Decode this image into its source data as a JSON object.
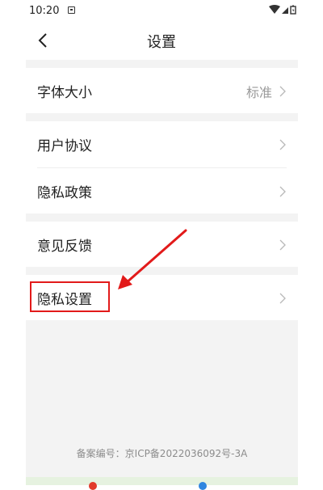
{
  "status_bar": {
    "time": "10:20",
    "icons": [
      "notification-icon",
      "wifi-icon",
      "signal-icon",
      "battery-icon"
    ]
  },
  "nav": {
    "title": "设置",
    "back_icon": "back-arrow-icon"
  },
  "settings": {
    "font_size": {
      "label": "字体大小",
      "value": "标准"
    },
    "user_agreement": {
      "label": "用户协议"
    },
    "privacy_policy": {
      "label": "隐私政策"
    },
    "feedback": {
      "label": "意见反馈"
    },
    "privacy_settings": {
      "label": "隐私设置"
    }
  },
  "annotation": {
    "color": "#e21a1a"
  },
  "footer": {
    "icp": "备案编号：京ICP备2022036092号-3A"
  },
  "colors": {
    "background": "#f3f3f3",
    "secondary_text": "#9a9a9a"
  }
}
